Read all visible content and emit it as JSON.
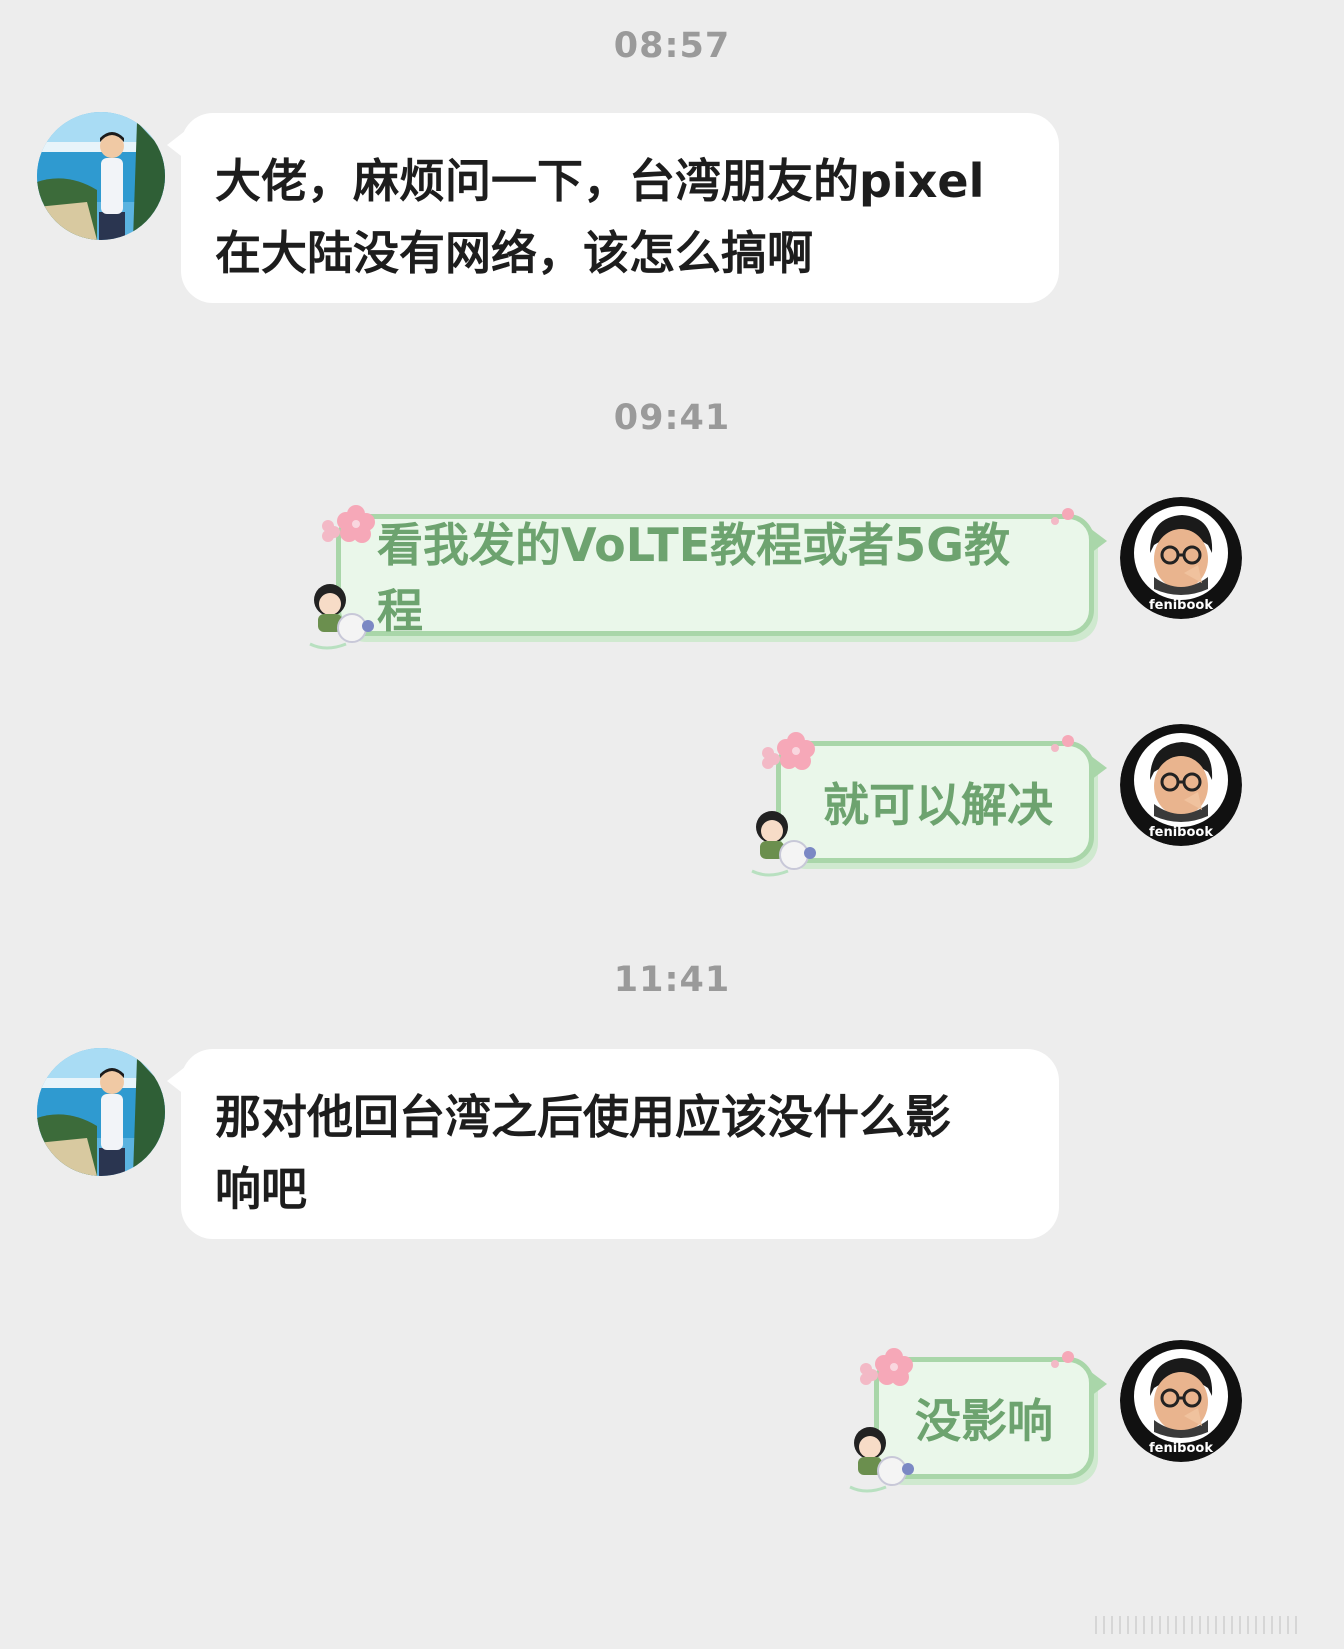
{
  "timestamps": [
    "08:57",
    "09:41",
    "11:41"
  ],
  "messages": [
    {
      "side": "left",
      "lines": [
        "大佬，麻烦问一下，台湾朋友的pixel",
        "在大陆没有网络，该怎么搞啊"
      ]
    },
    {
      "side": "right",
      "text": "看我发的VoLTE教程或者5G教程"
    },
    {
      "side": "right",
      "text": "就可以解决"
    },
    {
      "side": "left",
      "lines": [
        "那对他回台湾之后使用应该没什么影",
        "响吧"
      ]
    },
    {
      "side": "right",
      "text": "没影响"
    }
  ],
  "avatar_self_label": "fenibook",
  "colors": {
    "background": "#ededed",
    "incoming_bubble": "#ffffff",
    "outgoing_bubble": "#eaf7ea",
    "outgoing_border": "#a9d6a9",
    "outgoing_text": "#6da36f",
    "timestamp_text": "#9a9a9a"
  },
  "icons": {
    "contact_avatar": "avatar-seaside-person-icon",
    "self_avatar": "avatar-glasses-man-icon",
    "bubble_decoration": "sakura-flower-icon",
    "bubble_sticker": "chibi-characters-icon"
  }
}
